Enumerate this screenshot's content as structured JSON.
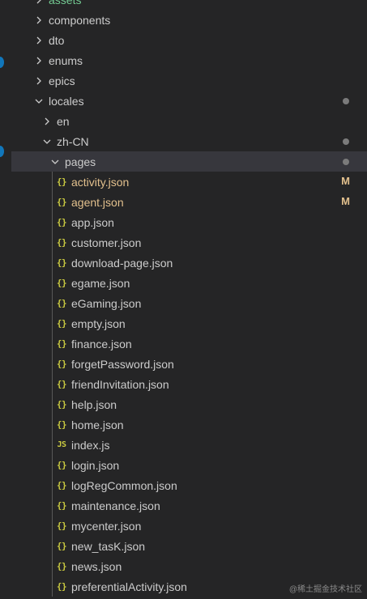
{
  "colors": {
    "background": "#252526",
    "selected_row": "#37373d",
    "text": "#cccccc",
    "modified": "#e2c08d",
    "folder_modified_dot": "#7b7b7b",
    "json_icon": "#cbcb41",
    "git_added": "#73c991",
    "side_marker": "#1177bb"
  },
  "tree": {
    "folders": {
      "assets": {
        "label": "assets"
      },
      "components": {
        "label": "components"
      },
      "dto": {
        "label": "dto"
      },
      "enums": {
        "label": "enums"
      },
      "epics": {
        "label": "epics"
      },
      "locales": {
        "label": "locales"
      },
      "en": {
        "label": "en"
      },
      "zh_cn": {
        "label": "zh-CN"
      },
      "pages": {
        "label": "pages"
      }
    },
    "files": [
      {
        "label": "activity.json",
        "icon": "json-braces-icon",
        "status": "M"
      },
      {
        "label": "agent.json",
        "icon": "json-braces-icon",
        "status": "M"
      },
      {
        "label": "app.json",
        "icon": "json-braces-icon"
      },
      {
        "label": "customer.json",
        "icon": "json-braces-icon"
      },
      {
        "label": "download-page.json",
        "icon": "json-braces-icon"
      },
      {
        "label": "egame.json",
        "icon": "json-braces-icon"
      },
      {
        "label": "eGaming.json",
        "icon": "json-braces-icon"
      },
      {
        "label": "empty.json",
        "icon": "json-braces-icon"
      },
      {
        "label": "finance.json",
        "icon": "json-braces-icon"
      },
      {
        "label": "forgetPassword.json",
        "icon": "json-braces-icon"
      },
      {
        "label": "friendInvitation.json",
        "icon": "json-braces-icon"
      },
      {
        "label": "help.json",
        "icon": "json-braces-icon"
      },
      {
        "label": "home.json",
        "icon": "json-braces-icon"
      },
      {
        "label": "index.js",
        "icon": "js-icon"
      },
      {
        "label": "login.json",
        "icon": "json-braces-icon"
      },
      {
        "label": "logRegCommon.json",
        "icon": "json-braces-icon"
      },
      {
        "label": "maintenance.json",
        "icon": "json-braces-icon"
      },
      {
        "label": "mycenter.json",
        "icon": "json-braces-icon"
      },
      {
        "label": "new_tasK.json",
        "icon": "json-braces-icon"
      },
      {
        "label": "news.json",
        "icon": "json-braces-icon"
      },
      {
        "label": "preferentialActivity.json",
        "icon": "json-braces-icon"
      }
    ],
    "icon_glyphs": {
      "json": "{}",
      "js": "JS"
    }
  },
  "watermark": "@稀土掘金技术社区"
}
